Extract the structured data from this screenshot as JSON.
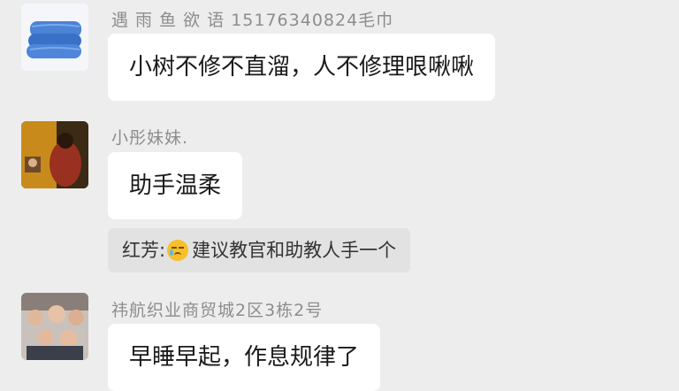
{
  "messages": [
    {
      "sender": "遇 雨 鱼 欲 语 15176340824毛巾",
      "text": "小树不修不直溜，人不修理哏啾啾",
      "avatar": "towel-avatar"
    },
    {
      "sender": "小彤妹妹.",
      "text": "助手温柔",
      "avatar": "portrait-avatar"
    },
    {
      "quote_author": "红芳:",
      "quote_text": "建议教官和助教人手一个",
      "quote_icon": "crying-laughing-emoji-icon"
    },
    {
      "sender": "祎航织业商贸城2区3栋2号",
      "text": "早睡早起，作息规律了",
      "avatar": "group-photo-avatar"
    }
  ],
  "colors": {
    "background": "#ededed",
    "bubble": "#ffffff",
    "quote_bg": "#e2e2e2",
    "sender_text": "#8d8d8d"
  }
}
